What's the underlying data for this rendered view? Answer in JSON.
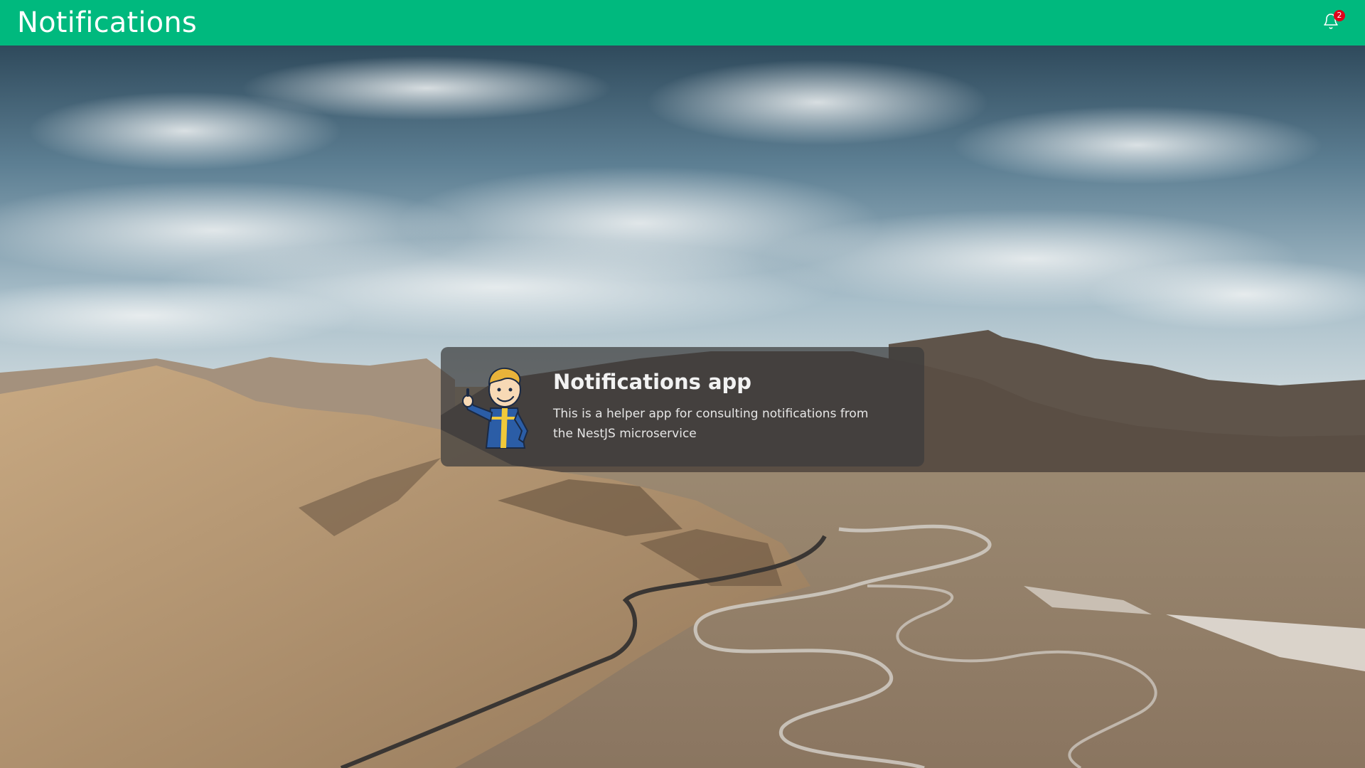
{
  "appbar": {
    "title": "Notifications",
    "notification_icon": "bell-icon",
    "notification_count": "2"
  },
  "card": {
    "image": "vault-boy-mascot",
    "title": "Notifications app",
    "description": "This is a helper app for consulting notifications from the NestJS microservice"
  },
  "background": {
    "image": "desert-mountain-valley-landscape"
  },
  "colors": {
    "appbar": "#00b97e",
    "badge": "#e0001b",
    "card_background": "rgba(60,60,60,0.72)"
  }
}
